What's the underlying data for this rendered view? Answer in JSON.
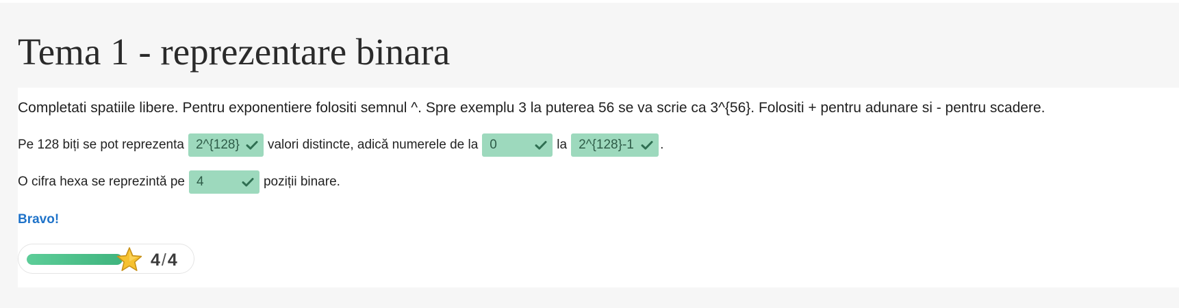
{
  "header": {
    "title": "Tema 1 - reprezentare binara"
  },
  "main": {
    "instructions": "Completati spatiile libere. Pentru exponentiere folositi semnul ^. Spre exemplu 3 la puterea 56 se va scrie ca 3^{56}. Folositi + pentru adunare si - pentru scadere.",
    "question1": {
      "text_before": "Pe 128 biți se pot reprezenta",
      "answer1": "2^{128}",
      "text_middle": "valori distincte, adică numerele de la",
      "answer2": "0",
      "text_la": "la",
      "answer3": "2^{128}-1",
      "text_after": "."
    },
    "question2": {
      "text_before": "O cifra hexa se reprezintă pe",
      "answer": "4",
      "text_after": "poziții binare."
    },
    "feedback": "Bravo!",
    "score": {
      "earned": "4",
      "separator": "/",
      "total": "4",
      "progress_fraction": 1.0
    }
  },
  "icons": {
    "answer_status": "check-icon",
    "score_badge": "star-icon"
  },
  "colors": {
    "correct_answer_bg": "#9dd9bd",
    "feedback_text": "#1f73c9",
    "progress_fill": "#4cc08a",
    "star_fill": "#f6c12f"
  }
}
